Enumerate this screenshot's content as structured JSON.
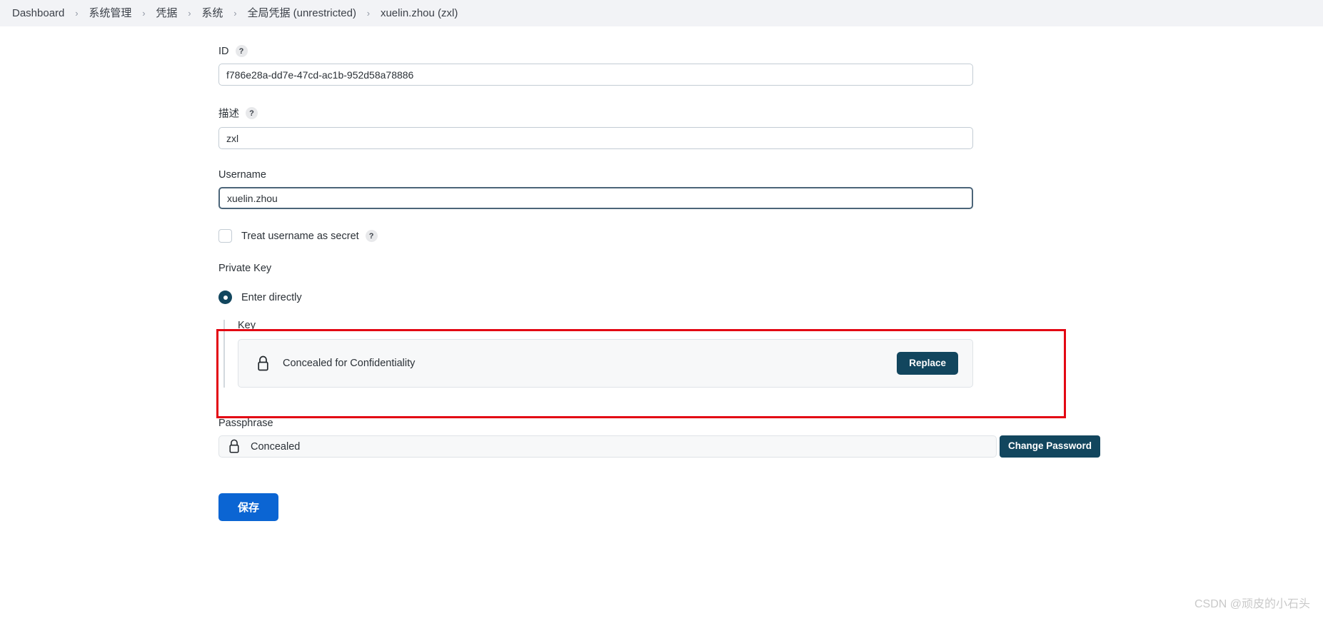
{
  "breadcrumb": {
    "separator": "›",
    "items": [
      {
        "label": "Dashboard"
      },
      {
        "label": "系统管理"
      },
      {
        "label": "凭据"
      },
      {
        "label": "系统"
      },
      {
        "label": "全局凭据 (unrestricted)"
      },
      {
        "label": "xuelin.zhou (zxl)"
      }
    ]
  },
  "form": {
    "id_field": {
      "label": "ID",
      "help": "?",
      "value": "f786e28a-dd7e-47cd-ac1b-952d58a78886"
    },
    "description_field": {
      "label": "描述",
      "help": "?",
      "value": "zxl"
    },
    "username_field": {
      "label": "Username",
      "value": "xuelin.zhou"
    },
    "treat_username_as_secret": {
      "label": "Treat username as secret",
      "help": "?",
      "checked": false
    },
    "private_key": {
      "label": "Private Key",
      "option_label": "Enter directly",
      "option_selected": true,
      "key_label": "Key",
      "concealed_text": "Concealed for Confidentiality",
      "replace_button": "Replace"
    },
    "passphrase": {
      "label": "Passphrase",
      "value": "Concealed",
      "change_button": "Change Password"
    },
    "save_button": "保存"
  },
  "watermark": "CSDN @顽皮的小石头",
  "colors": {
    "accent_blue": "#0b65d3",
    "navy": "#12465e",
    "highlight_red": "#e30613",
    "breadcrumb_bg": "#f2f3f6"
  }
}
